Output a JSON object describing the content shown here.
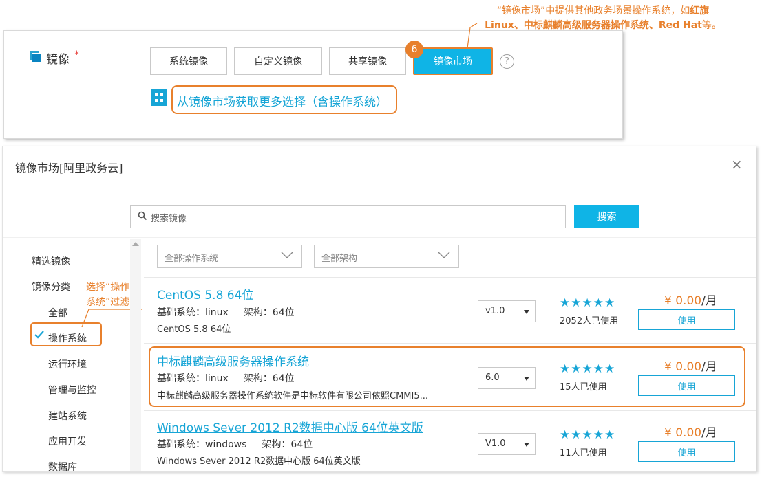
{
  "top_panel": {
    "label": "镜像",
    "required_mark": "*",
    "tabs": [
      "系统镜像",
      "自定义镜像",
      "共享镜像",
      "镜像市场"
    ],
    "step_badge": "6",
    "help_icon": "?",
    "market_link": "从镜像市场获取更多选择（含操作系统）"
  },
  "callout_top": {
    "line1_pre": "“镜像市场”中提供其他政务场景操作系统，如",
    "line1_bold": "红旗",
    "line2_bold": "Linux、中标麒麟高级服务器操作系统、Red Hat",
    "line2_post": "等。"
  },
  "dialog": {
    "title": "镜像市场[阿里政务云]",
    "close_icon": "×",
    "search_placeholder": "搜索镜像",
    "search_button": "搜索",
    "sidebar": {
      "featured": "精选镜像",
      "category": "镜像分类",
      "items": [
        "全部",
        "操作系统",
        "运行环境",
        "管理与监控",
        "建站系统",
        "应用开发",
        "数据库"
      ]
    },
    "callout_left": [
      "选择“操作",
      "系统”过滤"
    ],
    "filters": [
      "全部操作系统",
      "全部架构"
    ],
    "list": [
      {
        "title": "CentOS 5.8 64位",
        "base_label": "基础系统：linux",
        "arch_label": "架构：64位",
        "desc": "CentOS 5.8 64位",
        "version": "v1.0",
        "stars": "★★★★★",
        "used": "2052人已使用",
        "price": "¥ 0.00",
        "unit": "/月",
        "button": "使用"
      },
      {
        "title": "中标麒麟高级服务器操作系统",
        "base_label": "基础系统：linux",
        "arch_label": "架构：64位",
        "desc": "中标麒麟高级服务器操作系统软件是中标软件有限公司依照CMMI5...",
        "version": "6.0",
        "stars": "★★★★★",
        "used": "15人已使用",
        "price": "¥ 0.00",
        "unit": "/月",
        "button": "使用"
      },
      {
        "title": "Windows Sever 2012 R2数据中心版 64位英文版",
        "base_label": "基础系统：windows",
        "arch_label": "架构：64位",
        "desc": "Windows Sever 2012 R2数据中心版 64位英文版",
        "version": "V1.0",
        "stars": "★★★★★",
        "used": "11人已使用",
        "price": "¥ 0.00",
        "unit": "/月",
        "button": "使用"
      }
    ]
  },
  "colors": {
    "accent": "#0fb4e6",
    "link": "#17a5d6",
    "annotation": "#e8802c"
  }
}
